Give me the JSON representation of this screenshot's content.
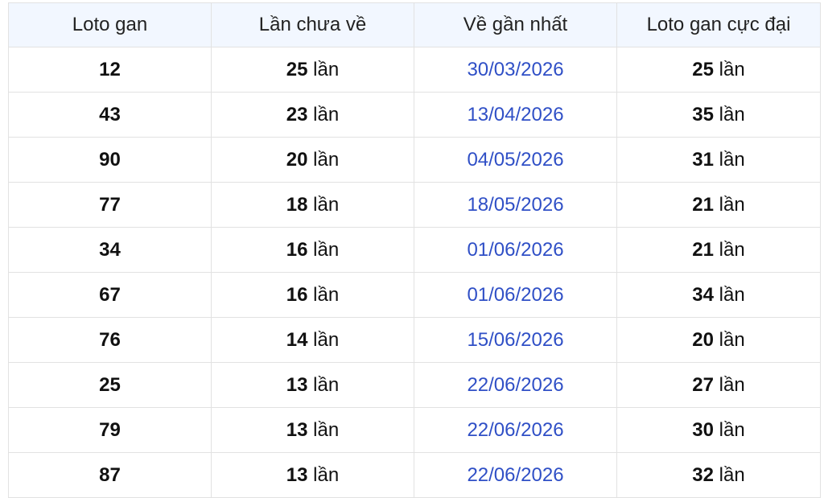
{
  "table": {
    "headers": [
      "Loto gan",
      "Lần chưa về",
      "Về gần nhất",
      "Loto gan cực đại"
    ],
    "rows": [
      {
        "loto": "12",
        "missed": "25",
        "unit_missed": "lần",
        "last": "30/03/2026",
        "max": "25",
        "unit_max": "lần"
      },
      {
        "loto": "43",
        "missed": "23",
        "unit_missed": "lần",
        "last": "13/04/2026",
        "max": "35",
        "unit_max": "lần"
      },
      {
        "loto": "90",
        "missed": "20",
        "unit_missed": "lần",
        "last": "04/05/2026",
        "max": "31",
        "unit_max": "lần"
      },
      {
        "loto": "77",
        "missed": "18",
        "unit_missed": "lần",
        "last": "18/05/2026",
        "max": "21",
        "unit_max": "lần"
      },
      {
        "loto": "34",
        "missed": "16",
        "unit_missed": "lần",
        "last": "01/06/2026",
        "max": "21",
        "unit_max": "lần"
      },
      {
        "loto": "67",
        "missed": "16",
        "unit_missed": "lần",
        "last": "01/06/2026",
        "max": "34",
        "unit_max": "lần"
      },
      {
        "loto": "76",
        "missed": "14",
        "unit_missed": "lần",
        "last": "15/06/2026",
        "max": "20",
        "unit_max": "lần"
      },
      {
        "loto": "25",
        "missed": "13",
        "unit_missed": "lần",
        "last": "22/06/2026",
        "max": "27",
        "unit_max": "lần"
      },
      {
        "loto": "79",
        "missed": "13",
        "unit_missed": "lần",
        "last": "22/06/2026",
        "max": "30",
        "unit_max": "lần"
      },
      {
        "loto": "87",
        "missed": "13",
        "unit_missed": "lần",
        "last": "22/06/2026",
        "max": "32",
        "unit_max": "lần"
      }
    ]
  },
  "colors": {
    "header_bg": "#f2f7ff",
    "date_text": "#2f4fc6",
    "border": "#e2e2e2"
  }
}
